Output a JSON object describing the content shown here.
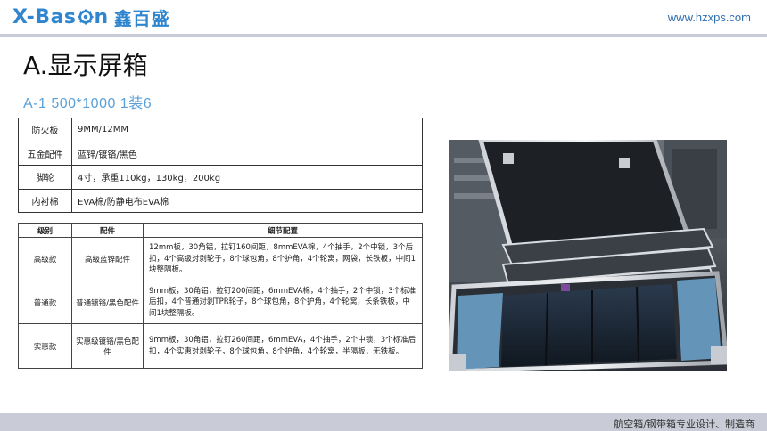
{
  "header": {
    "logo_text_1": "X-Bas",
    "logo_text_2": "n",
    "logo_cn": "鑫百盛",
    "url": "www.hzxps.com"
  },
  "title": "A.显示屏箱",
  "subtitle": "A-1    500*1000  1装6",
  "specs": [
    {
      "key": "防火板",
      "value": "9MM/12MM"
    },
    {
      "key": "五金配件",
      "value": "蓝锌/镀铬/黑色"
    },
    {
      "key": "脚轮",
      "value": "4寸，承重110kg，130kg，200kg"
    },
    {
      "key": "内衬棉",
      "value": "EVA棉/防静电布EVA棉"
    }
  ],
  "config": {
    "headers": [
      "级别",
      "配件",
      "细节配置"
    ],
    "rows": [
      {
        "level": "高级款",
        "parts": "高级蓝锌配件",
        "detail": "12mm板，30角铝，拉钉160间距，8mmEVA棉，4个抽手，2个中锁，3个后扣，4个高级对剥轮子，8个球包角，8个护角，4个轮窝，网袋，长铁板，中间1块整隔板。"
      },
      {
        "level": "普通款",
        "parts": "普通镀铬/黑色配件",
        "detail": "9mm板，30角铝，拉钉200间距，6mmEVA棉，4个抽手，2个中锁，3个标准后扣，4个普通对剥TPR轮子，8个球包角，8个护角，4个轮窝，长条铁板，中间1块整隔板。"
      },
      {
        "level": "实惠款",
        "parts": "实惠级镀铬/黑色配件",
        "detail": "9mm板，30角铝，拉钉260间距，6mmEVA，4个抽手，2个中锁，3个标准后扣，4个实惠对剥轮子，8个球包角，8个护角，4个轮窝，半隔板，无铁板。"
      }
    ]
  },
  "footer": "航空箱/钢带箱专业设计、制造商",
  "colors": {
    "brand": "#2f86cf",
    "subtitle": "#5aa0d8",
    "rule": "#c9ccd6"
  }
}
